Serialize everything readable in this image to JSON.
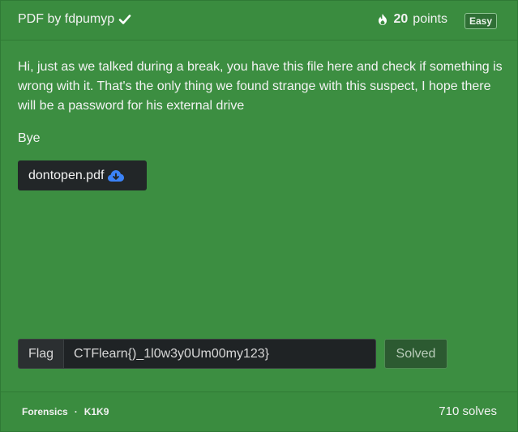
{
  "challenge": {
    "title": "PDF by fdpumyp",
    "points_value": "20",
    "points_label": "points",
    "difficulty": "Easy",
    "description": "Hi, just as we talked during a break, you have this file here and check if something is wrong with it. That's the only thing we found strange with this suspect, I hope there will be a password for his external drive",
    "closing": "Bye",
    "file_name": "dontopen.pdf",
    "icons": {
      "title": "check-icon",
      "points": "fire-icon",
      "file": "cloud-download-icon"
    }
  },
  "flag_form": {
    "label": "Flag",
    "value": "CTFlearn{)_1l0w3y0Um00my123}",
    "submit_label": "Solved"
  },
  "footer": {
    "category": "Forensics",
    "separator": "·",
    "author": "K1K9",
    "solves": "710 solves"
  },
  "colors": {
    "card_background": "#3c8e41",
    "dark_control": "#222628",
    "accent_blue": "#3b82f6"
  }
}
